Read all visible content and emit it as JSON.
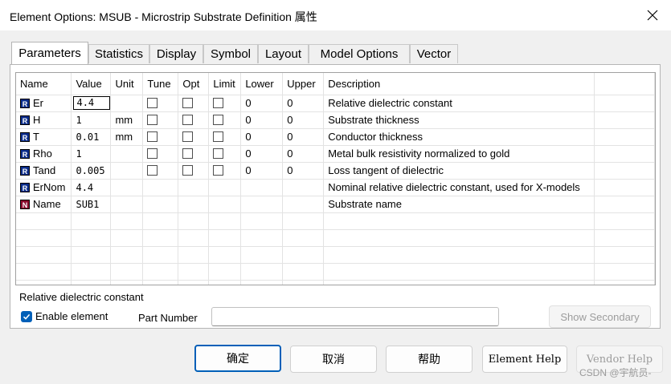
{
  "window": {
    "title": "Element Options: MSUB - Microstrip Substrate Definition 属性"
  },
  "tabs": [
    {
      "label": "Parameters",
      "active": true
    },
    {
      "label": "Statistics",
      "active": false
    },
    {
      "label": "Display",
      "active": false
    },
    {
      "label": "Symbol",
      "active": false
    },
    {
      "label": "Layout",
      "active": false
    },
    {
      "label": "Model Options",
      "active": false
    },
    {
      "label": "Vector",
      "active": false
    }
  ],
  "grid": {
    "columns": [
      "Name",
      "Value",
      "Unit",
      "Tune",
      "Opt",
      "Limit",
      "Lower",
      "Upper",
      "Description"
    ],
    "rows": [
      {
        "type": "R",
        "name": "Er",
        "value": "4.4",
        "unit": "",
        "checks": true,
        "lower": "0",
        "upper": "0",
        "description": "Relative dielectric constant",
        "editing": true
      },
      {
        "type": "R",
        "name": "H",
        "value": "1",
        "unit": "mm",
        "checks": true,
        "lower": "0",
        "upper": "0",
        "description": "Substrate thickness"
      },
      {
        "type": "R",
        "name": "T",
        "value": "0.01",
        "unit": "mm",
        "checks": true,
        "lower": "0",
        "upper": "0",
        "description": "Conductor thickness"
      },
      {
        "type": "R",
        "name": "Rho",
        "value": "1",
        "unit": "",
        "checks": true,
        "lower": "0",
        "upper": "0",
        "description": "Metal bulk resistivity normalized to gold"
      },
      {
        "type": "R",
        "name": "Tand",
        "value": "0.005",
        "unit": "",
        "checks": true,
        "lower": "0",
        "upper": "0",
        "description": "Loss tangent of dielectric"
      },
      {
        "type": "R",
        "name": "ErNom",
        "value": "4.4",
        "unit": "",
        "checks": false,
        "lower": "",
        "upper": "",
        "description": "Nominal relative dielectric constant, used for X-models"
      },
      {
        "type": "N",
        "name": "Name",
        "value": "SUB1",
        "unit": "",
        "checks": false,
        "lower": "",
        "upper": "",
        "description": "Substrate name"
      }
    ],
    "empty_rows": 5
  },
  "hint": "Relative dielectric constant",
  "enable_element": {
    "label": "Enable element",
    "checked": true
  },
  "part_number": {
    "label": "Part Number",
    "value": ""
  },
  "show_secondary_label": "Show Secondary",
  "buttons": {
    "ok": "确定",
    "cancel": "取消",
    "help": "帮助",
    "element_help": "Element Help",
    "vendor_help": "Vendor Help"
  },
  "watermark": "CSDN @宇航员-",
  "colors": {
    "accent": "#005fb8",
    "type_R": "#0a2c8a",
    "type_N": "#8a0a2c"
  }
}
